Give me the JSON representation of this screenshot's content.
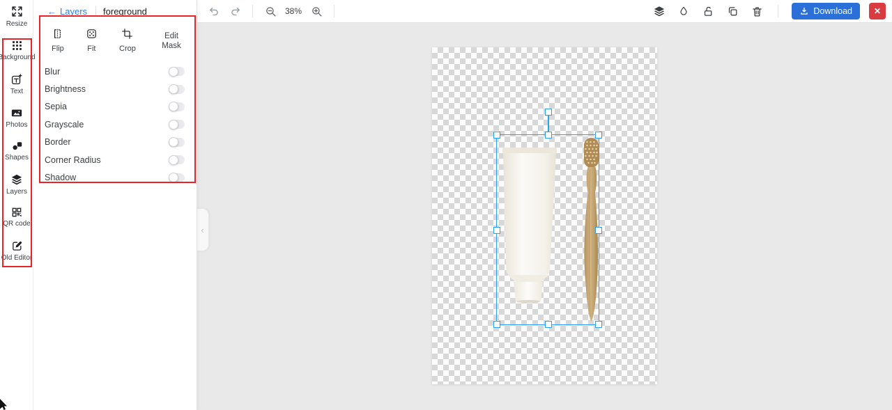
{
  "sidebar": {
    "resize": {
      "label": "Resize"
    },
    "items": [
      {
        "label": "Background"
      },
      {
        "label": "Text"
      },
      {
        "label": "Photos"
      },
      {
        "label": "Shapes"
      },
      {
        "label": "Layers"
      },
      {
        "label": "QR code"
      },
      {
        "label": "Old Editor"
      }
    ]
  },
  "panel": {
    "back_label": "Layers",
    "layer_name": "foreground",
    "actions": [
      {
        "label": "Flip"
      },
      {
        "label": "Fit"
      },
      {
        "label": "Crop"
      },
      {
        "label": "Edit Mask"
      }
    ],
    "toggles": [
      {
        "label": "Blur",
        "state": "off"
      },
      {
        "label": "Brightness",
        "state": "off"
      },
      {
        "label": "Sepia",
        "state": "off"
      },
      {
        "label": "Grayscale",
        "state": "off"
      },
      {
        "label": "Border",
        "state": "off"
      },
      {
        "label": "Corner Radius",
        "state": "off"
      },
      {
        "label": "Shadow",
        "state": "off"
      }
    ]
  },
  "toolbar": {
    "zoom_level": "38%",
    "download_label": "Download"
  },
  "glyphs": {
    "back_arrow": "←",
    "flap_chevron": "‹",
    "close": "✕"
  },
  "colors": {
    "link_blue": "#2d7ff2",
    "selection_blue": "#2aa2f0",
    "download_blue": "#2b6fd9",
    "close_red": "#d93b40",
    "annotation_red": "#e8242a",
    "canvas_gray": "#e9e9e9"
  }
}
